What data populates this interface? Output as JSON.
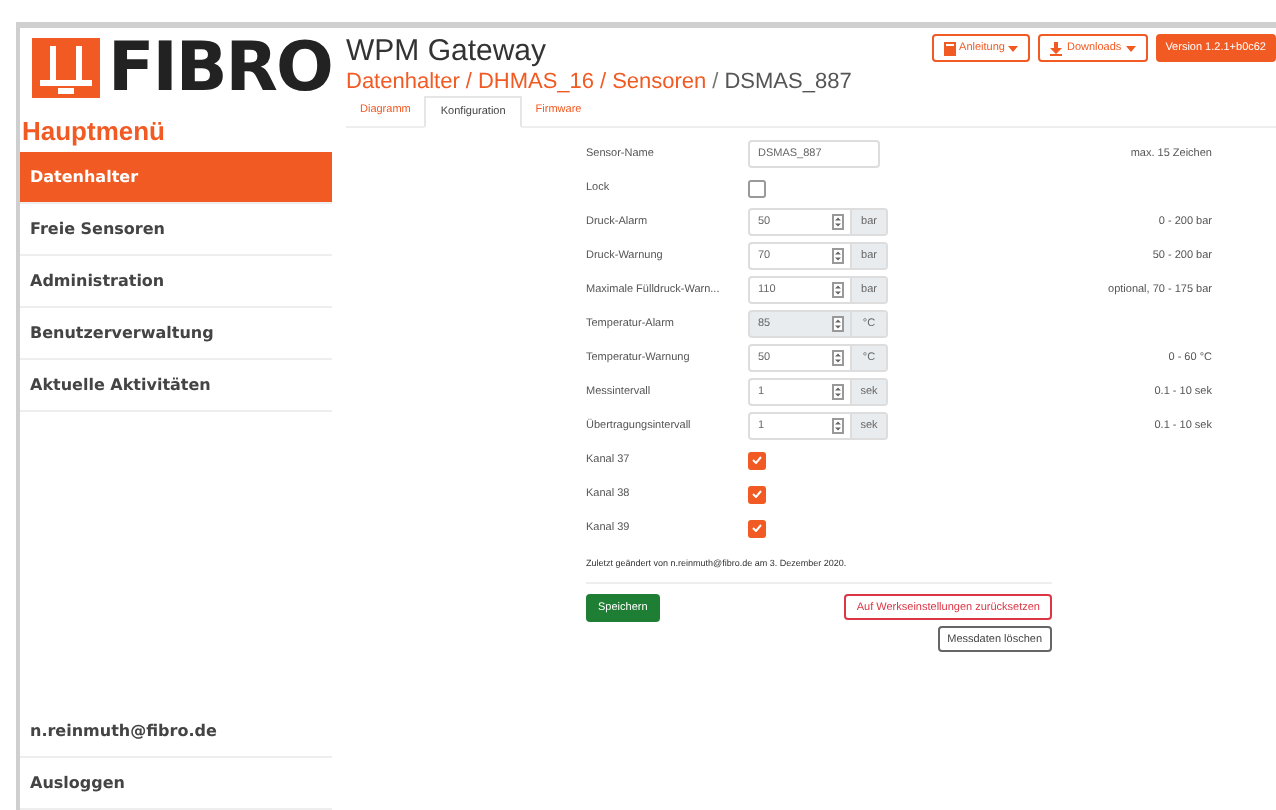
{
  "logo": {
    "text": "FIBRO"
  },
  "sidebar": {
    "title": "Hauptmenü",
    "items": [
      {
        "label": "Datenhalter",
        "selected": true
      },
      {
        "label": "Freie Sensoren",
        "selected": false
      },
      {
        "label": "Administration",
        "selected": false
      },
      {
        "label": "Benutzerverwaltung",
        "selected": false
      },
      {
        "label": "Aktuelle Aktivitäten",
        "selected": false
      }
    ],
    "footer": [
      {
        "label": "n.reinmuth@fibro.de"
      },
      {
        "label": "Ausloggen"
      }
    ]
  },
  "header": {
    "title": "WPM Gateway",
    "breadcrumb": [
      {
        "label": "Datenhalter",
        "kind": "link"
      },
      {
        "label": "/",
        "kind": "separator"
      },
      {
        "label": "DHMAS_16",
        "kind": "link"
      },
      {
        "label": "/",
        "kind": "separator"
      },
      {
        "label": "Sensoren",
        "kind": "link"
      },
      {
        "label": "/",
        "kind": "separator"
      },
      {
        "label": "DSMAS_887",
        "kind": "current"
      }
    ],
    "buttons": [
      {
        "label": "Anleitung",
        "kind": "book"
      },
      {
        "label": "Downloads",
        "kind": "download"
      },
      {
        "label": "Version 1.2.1+b0c62",
        "kind": "version"
      }
    ]
  },
  "tabs": [
    {
      "label": "Diagramm",
      "selected": false
    },
    {
      "label": "Konfiguration",
      "selected": true
    },
    {
      "label": "Firmware",
      "selected": false
    }
  ],
  "form": [
    {
      "kind": "text",
      "label": "Sensor-Name",
      "value": "DSMAS_887",
      "hint": "max. 15 Zeichen"
    },
    {
      "kind": "checkbox",
      "label": "Lock",
      "checked": false
    },
    {
      "kind": "number",
      "label": "Druck-Alarm",
      "value": "50",
      "unit": "bar",
      "disabled": false,
      "hint": "0 - 200 bar"
    },
    {
      "kind": "number",
      "label": "Druck-Warnung",
      "value": "70",
      "unit": "bar",
      "disabled": false,
      "hint": "50 - 200 bar"
    },
    {
      "kind": "number",
      "label": "Maximale Fülldruck-Warn...",
      "value": "110",
      "unit": "bar",
      "disabled": false,
      "hint": "optional, 70 - 175 bar"
    },
    {
      "kind": "number",
      "label": "Temperatur-Alarm",
      "value": "85",
      "unit": "°C",
      "disabled": true
    },
    {
      "kind": "number",
      "label": "Temperatur-Warnung",
      "value": "50",
      "unit": "°C",
      "disabled": false,
      "hint": "0 - 60 °C"
    },
    {
      "kind": "number",
      "label": "Messintervall",
      "value": "1",
      "unit": "sek",
      "disabled": false,
      "hint": "0.1 - 10 sek"
    },
    {
      "kind": "number",
      "label": "Übertragungsintervall",
      "value": "1",
      "unit": "sek",
      "disabled": false,
      "hint": "0.1 - 10 sek"
    },
    {
      "kind": "checkbox",
      "label": "Kanal 37",
      "checked": true
    },
    {
      "kind": "checkbox",
      "label": "Kanal 38",
      "checked": true
    },
    {
      "kind": "checkbox",
      "label": "Kanal 39",
      "checked": true
    }
  ],
  "note": "Zuletzt geändert von n.reinmuth@fibro.de am 3. Dezember 2020.",
  "actions": {
    "save": "Speichern",
    "reset": "Auf Werkseinstellungen zurücksetzen",
    "delete": "Messdaten löschen"
  }
}
